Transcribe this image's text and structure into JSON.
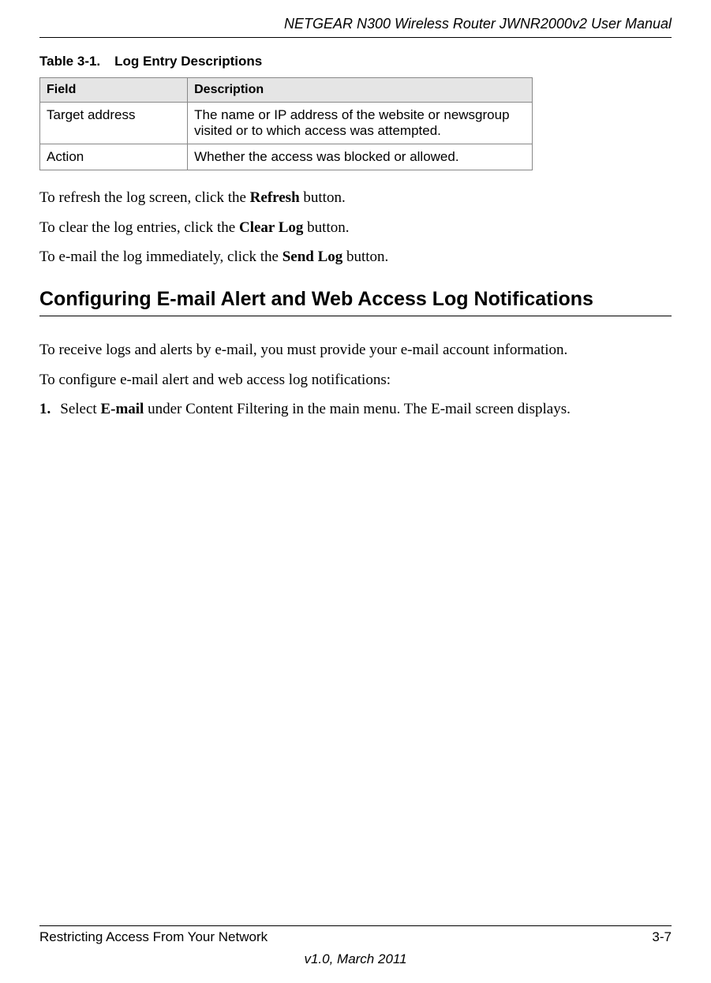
{
  "header": {
    "title": "NETGEAR N300 Wireless Router JWNR2000v2 User Manual"
  },
  "table": {
    "caption_number": "Table 3-1.",
    "caption_title": "Log Entry Descriptions",
    "headers": {
      "field": "Field",
      "description": "Description"
    },
    "rows": [
      {
        "field": "Target address",
        "description": "The name or IP address of the website or newsgroup visited or to which access was attempted."
      },
      {
        "field": "Action",
        "description": "Whether the access was blocked or allowed."
      }
    ]
  },
  "paragraphs": {
    "p1_a": "To refresh the log screen, click the ",
    "p1_bold": "Refresh",
    "p1_b": " button.",
    "p2_a": "To clear the log entries, click the ",
    "p2_bold": "Clear Log",
    "p2_b": " button.",
    "p3_a": "To e-mail the log immediately, click the ",
    "p3_bold": "Send Log",
    "p3_b": " button."
  },
  "section_heading": "Configuring E-mail Alert and Web Access Log Notifications",
  "intro_paragraphs": {
    "i1": "To receive logs and alerts by e-mail, you must provide your e-mail account information.",
    "i2": "To configure e-mail alert and web access log notifications:"
  },
  "step1": {
    "num": "1.",
    "a": "Select ",
    "bold": "E-mail",
    "b": " under Content Filtering in the main menu. The E-mail screen displays."
  },
  "footer": {
    "section": "Restricting Access From Your Network",
    "page": "3-7",
    "version": "v1.0, March 2011"
  }
}
